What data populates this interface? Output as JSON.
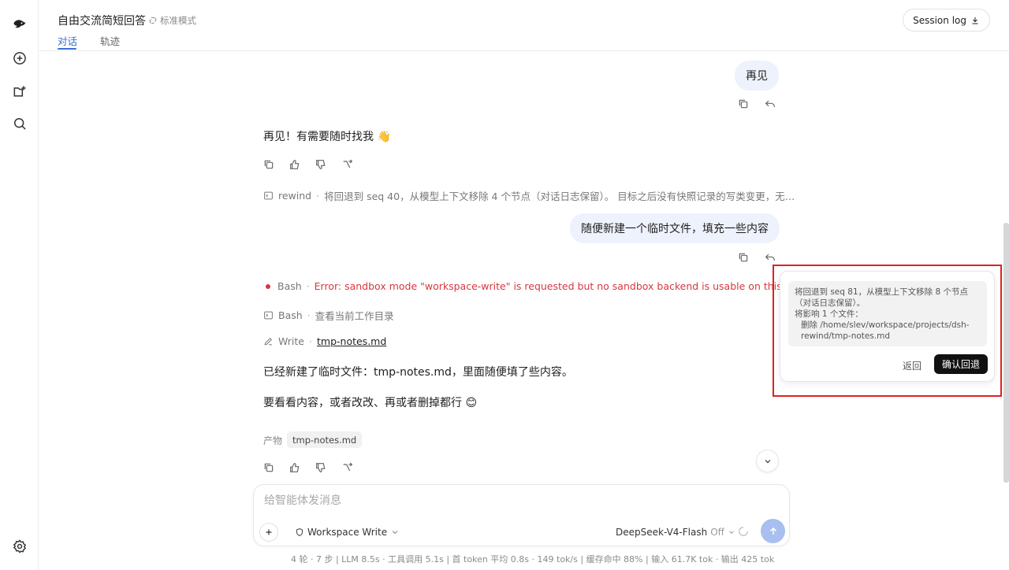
{
  "header": {
    "title": "自由交流简短回答",
    "mode": "标准模式",
    "tabs": [
      {
        "label": "对话",
        "active": true
      },
      {
        "label": "轨迹",
        "active": false
      }
    ],
    "session_button": "Session log"
  },
  "rail": {
    "icons": [
      "logo-icon",
      "new-chat-icon",
      "add-project-icon",
      "search-icon",
      "settings-icon"
    ]
  },
  "messages": {
    "user_1": "再见",
    "assistant_1": "再见！有需要随时找我 👋",
    "rewind_tool": {
      "name": "rewind",
      "text": "将回退到 seq 40，从模型上下文移除 4 个节点（对话日志保留）。 目标之后没有快照记录的写类变更，无…"
    },
    "user_2": "随便新建一个临时文件，填充一些内容",
    "bash_error": {
      "name": "Bash",
      "text": "Error: sandbox mode \"workspace-write\" is requested but no sandbox backend is usable on this host; refusin…"
    },
    "bash_pwd": {
      "name": "Bash",
      "text": "查看当前工作目录"
    },
    "write": {
      "name": "Write",
      "file": "tmp-notes.md"
    },
    "assistant_2a": "已经新建了临时文件：tmp-notes.md，里面随便填了些内容。",
    "assistant_2b": "要看看内容，或者改改、再或者删掉都行 😊",
    "artifact_label": "产物",
    "artifact_chip": "tmp-notes.md"
  },
  "composer": {
    "placeholder": "给智能体发消息",
    "workspace": "Workspace Write",
    "model": "DeepSeek-V4-Flash",
    "model_toggle": "Off"
  },
  "stats": "4 轮 · 7 步  |  LLM 8.5s · 工具调用 5.1s  |  首 token 平均 0.8s · 149 tok/s  |  缓存命中 88%  |  输入 61.7K tok · 输出 425 tok",
  "popup": {
    "line1": "将回退到 seq 81，从模型上下文移除 8 个节点（对话日志保留）。",
    "line2": "将影响 1 个文件：",
    "line3": "删除 /home/slev/workspace/projects/dsh-rewind/tmp-notes.md",
    "back": "返回",
    "confirm": "确认回退"
  },
  "colors": {
    "accent": "#3a6fd8",
    "user_bubble": "#eef2fc",
    "error": "#d9363e",
    "send": "#a9bff0",
    "highlight": "#e02020"
  }
}
